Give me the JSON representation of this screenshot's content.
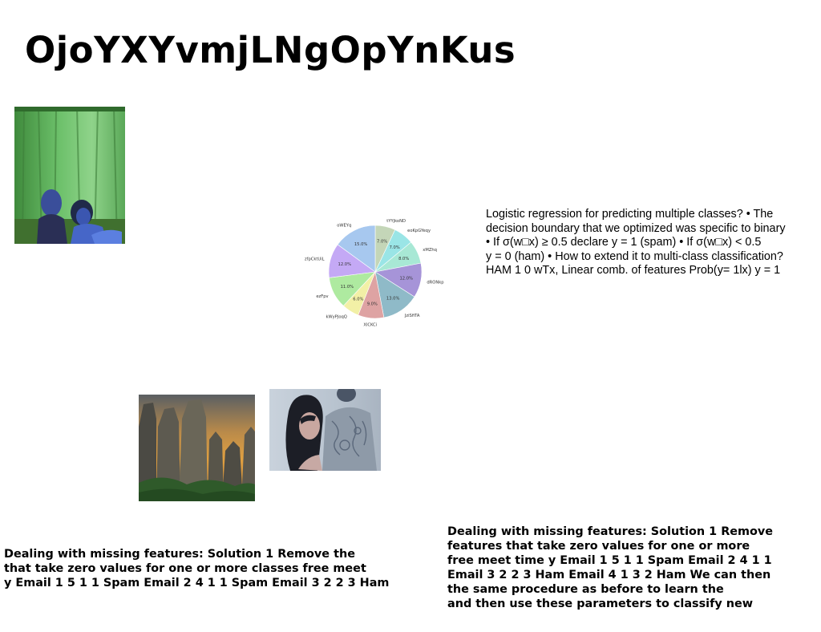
{
  "page": {
    "title": "OjoYXYvmjLNgOpYnKus"
  },
  "images": {
    "photo_1": "people-in-front-of-green-curtain",
    "photo_2": "rock-pillars-landscape",
    "photo_3": "woman-and-tattooed-man"
  },
  "chart_data": {
    "type": "pie",
    "categories": [
      "tYYjkoND",
      "eoKpGYeqy",
      "xMZhq",
      "dRONkp",
      "JziSfiTA",
      "XlCKCi",
      "kWyPJoqQ",
      "ezFpv",
      "zfpCktUiL",
      "oWEYq"
    ],
    "values": [
      7.0,
      7.0,
      8.0,
      12.0,
      13.0,
      9.0,
      6.0,
      11.0,
      12.0,
      15.0
    ],
    "value_labels": [
      "7.0%",
      "7.0%",
      "8.0%",
      "12.0%",
      "13.0%",
      "9.0%",
      "6.0%",
      "11.0%",
      "12.0%",
      "15.0%"
    ],
    "colors": [
      "#c4d6b8",
      "#9ae5e6",
      "#a8e8d5",
      "#a694d8",
      "#8fbac8",
      "#dea3a3",
      "#f2f0a6",
      "#aeeaa0",
      "#c4a9f5",
      "#a7c8ef"
    ],
    "start_angle_deg": 90,
    "direction": "clockwise"
  },
  "texts": {
    "paragraph_lines": [
      "Logistic regression for predicting multiple classes? • The",
      "decision boundary that we optimized was specific to binary",
      "• If σ(w□x) ≥ 0.5 declare y = 1 (spam) • If σ(w□x) < 0.5",
      "y = 0 (ham) • How to extend it to multi-class classification?",
      "HAM 1 0 wTx, Linear comb. of features Prob(y= 1lx) y = 1"
    ],
    "bold_left_lines": [
      "Dealing with missing features: Solution 1 Remove the",
      "that take zero values for one or more classes free meet",
      "y Email 1 5 1 1 Spam Email 2 4 1 1 Spam Email 3 2 2 3 Ham"
    ],
    "bold_right_lines": [
      "Dealing with missing features: Solution 1 Remove",
      "features that take zero values for one or more",
      "free meet time y Email 1 5 1 1 Spam Email 2 4 1 1",
      "Email 3 2 2 3 Ham Email 4 1 3 2 Ham We can then",
      "the same procedure as before to learn the",
      "and then use these parameters to classify new"
    ]
  }
}
